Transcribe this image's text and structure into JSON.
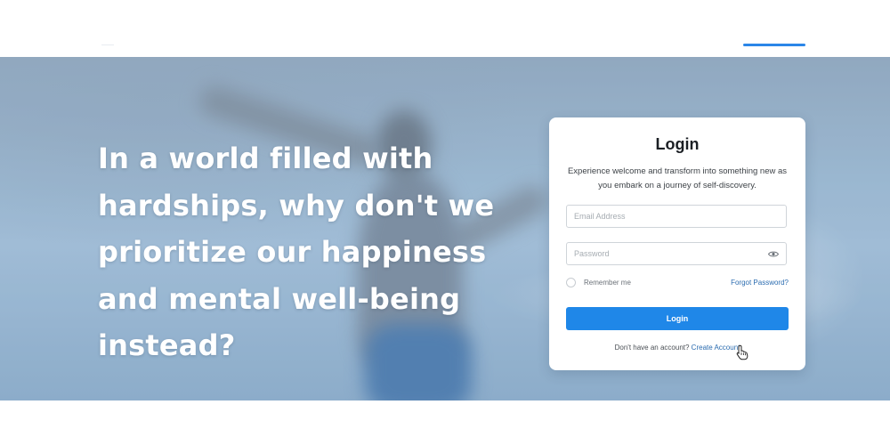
{
  "header": {
    "active_nav_color": "#2b86e8"
  },
  "hero": {
    "headline": "In a world filled with hardships, why don't we prioritize our happiness and mental well-being instead?"
  },
  "login": {
    "title": "Login",
    "subtitle": "Experience welcome and transform into something new as you embark on a journey of self-discovery.",
    "email_placeholder": "Email Address",
    "password_placeholder": "Password",
    "remember_label": "Remember me",
    "forgot_label": "Forgot Password?",
    "submit_label": "Login",
    "signup_prompt": "Don't have an account?",
    "signup_link": "Create Account",
    "accent_color": "#1f87e8",
    "link_color": "#2b6cb0"
  },
  "icons": {
    "password_toggle": "eye-icon",
    "pointer": "hand-cursor-icon"
  }
}
